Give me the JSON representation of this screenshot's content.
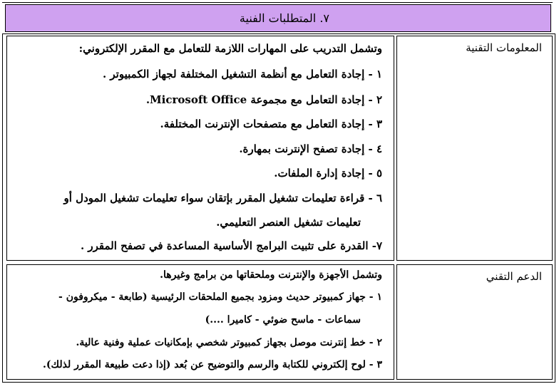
{
  "section_title": "٧. المتطلبات الفنية",
  "rows": [
    {
      "label": "المعلومات التقنية",
      "intro": "وتشمل التدريب على المهارات اللازمة للتعامل مع المقرر الإلكتروني:",
      "items": [
        "١ - إجادة التعامل مع أنظمة التشغيل المختلفة لجهاز الكمبيوتر .",
        "٢ - إجادة التعامل مع مجموعة Microsoft Office.",
        "٣ - إجادة التعامل مع متصفحات الإنترنت المختلفة.",
        "٤ - إجادة تصفح الإنترنت بمهارة.",
        "٥ - إجادة إدارة الملفات.",
        "٦ - قراءة تعليمات تشغيل المقرر بإتقان سواء تعليمات تشغيل المودل أو",
        "تعليمات تشغيل العنصر التعليمي.",
        "٧- القدرة على تثبيت البرامج الأساسية المساعدة في تصفح المقرر ."
      ]
    },
    {
      "label": "الدعم التقني",
      "intro": "وتشمل الأجهزة والإنترنت وملحقاتها من برامج وغيرها.",
      "items": [
        "١ - جهاز كمبيوتر حديث ومزود بجميع الملحقات الرئيسية (طابعة - ميكروفون -",
        "سماعات - ماسح ضوئي - كاميرا ....)",
        "٢ - خط إنترنت موصل بجهاز كمبيوتر شخصي بإمكانيات عملية وفنية عالية.",
        "٣ - لوح إلكتروني للكتابة والرسم والتوضيح عن بُعد (إذا دعت طبيعة المقرر لذلك)."
      ]
    }
  ]
}
